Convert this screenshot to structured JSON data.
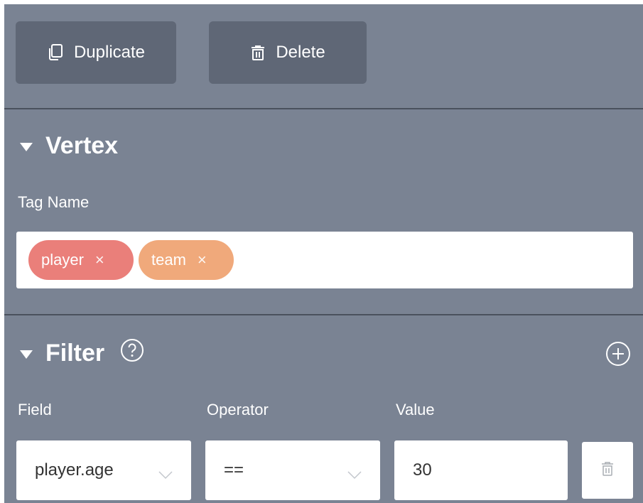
{
  "toolbar": {
    "duplicate_label": "Duplicate",
    "delete_label": "Delete"
  },
  "vertex": {
    "title": "Vertex",
    "tag_name_label": "Tag Name",
    "tags": [
      {
        "label": "player",
        "remove": "×",
        "color": "#ea7f7a"
      },
      {
        "label": "team",
        "remove": "×",
        "color": "#f0a97b"
      }
    ]
  },
  "filter": {
    "title": "Filter",
    "help_icon": "question-circle-icon",
    "add_icon": "plus-circle-icon",
    "columns": {
      "field": "Field",
      "operator": "Operator",
      "value": "Value"
    },
    "rows": [
      {
        "field": "player.age",
        "operator": "==",
        "value": "30",
        "delete_icon": "trash-icon"
      }
    ]
  },
  "colors": {
    "panel_bg": "#7a8393",
    "button_bg": "#5f6776",
    "divider": "#4a515d"
  }
}
